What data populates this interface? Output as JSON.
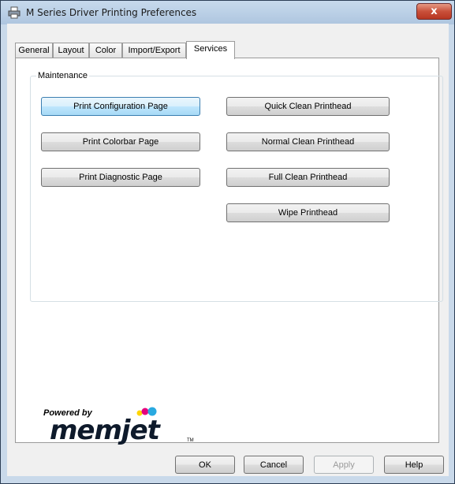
{
  "window": {
    "title": "M Series Driver Printing Preferences",
    "close_glyph": "x"
  },
  "tabs": [
    {
      "label": "General"
    },
    {
      "label": "Layout"
    },
    {
      "label": "Color"
    },
    {
      "label": "Import/Export"
    },
    {
      "label": "Services"
    }
  ],
  "active_tab": "Services",
  "maintenance": {
    "group_label": "Maintenance",
    "left_buttons": [
      {
        "label": "Print Configuration Page"
      },
      {
        "label": "Print Colorbar Page"
      },
      {
        "label": "Print Diagnostic Page"
      }
    ],
    "right_buttons": [
      {
        "label": "Quick Clean Printhead"
      },
      {
        "label": "Normal Clean Printhead"
      },
      {
        "label": "Full Clean Printhead"
      },
      {
        "label": "Wipe Printhead"
      }
    ]
  },
  "branding": {
    "powered_by": "Powered by",
    "logo": "memjet",
    "tm": "TM"
  },
  "footer": {
    "ok": "OK",
    "cancel": "Cancel",
    "apply": "Apply",
    "help": "Help"
  },
  "colors": {
    "dot_cyan": "#29a9e0",
    "dot_magenta": "#e5007e",
    "dot_yellow": "#ffd500",
    "logo": "#0e1a2b"
  },
  "icons": {
    "app": "printer-icon",
    "close": "close-icon"
  }
}
